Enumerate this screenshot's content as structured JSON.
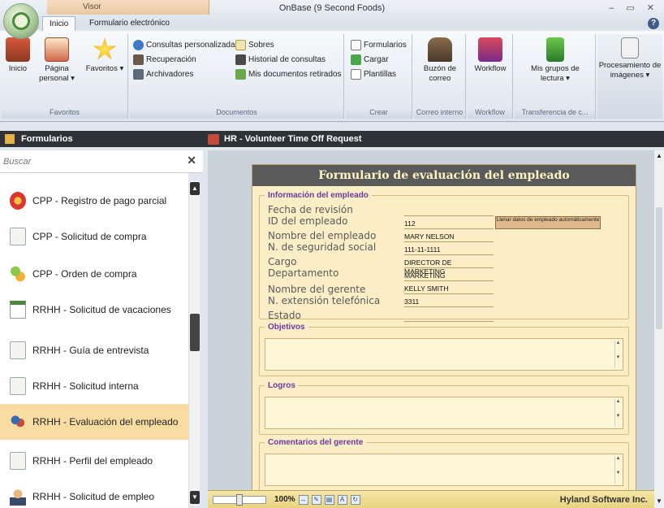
{
  "window": {
    "title": "OnBase (9 Second Foods)",
    "visor_tab": "Visor",
    "controls": "– ▭ ✕"
  },
  "ribbon_tabs": [
    {
      "label": "Inicio",
      "active": true
    },
    {
      "label": "Formulario electrónico",
      "active": false
    }
  ],
  "ribbon": {
    "groups": {
      "favoritos": "Favoritos",
      "documentos": "Documentos",
      "crear": "Crear",
      "correo": "Correo interno",
      "workflow": "Workflow",
      "transferencia": "Transferencia de c..."
    },
    "inicio": "Inicio",
    "pagina_personal": "Página personal ▾",
    "favoritos_btn": "Favoritos ▾",
    "consultas": "Consultas personalizadas",
    "recuperacion": "Recuperación",
    "archivadores": "Archivadores",
    "sobres": "Sobres",
    "historial": "Historial de consultas",
    "retirados": "Mis documentos retirados",
    "formularios": "Formularios",
    "cargar": "Cargar",
    "plantillas": "Plantillas",
    "buzon": "Buzón de correo",
    "workflow_btn": "Workflow",
    "mis_grupos": "Mis grupos de lectura ▾",
    "procesamiento": "Procesamiento de imágenes ▾"
  },
  "left_panel": {
    "title": "Formularios",
    "search_placeholder": "Buscar",
    "items": [
      {
        "label": "CPP - Registro de pago parcial"
      },
      {
        "label": "CPP - Solicitud de compra"
      },
      {
        "label": "CPP - Orden de compra"
      },
      {
        "label": "RRHH - Solicitud de vacaciones"
      },
      {
        "label": "RRHH - Guía de entrevista"
      },
      {
        "label": "RRHH - Solicitud interna"
      },
      {
        "label": "RRHH - Evaluación del empleado"
      },
      {
        "label": "RRHH - Perfil del empleado"
      },
      {
        "label": "RRHH - Solicitud de empleo"
      }
    ]
  },
  "viewer": {
    "title": "HR - Volunteer Time Off Request"
  },
  "form": {
    "title": "Formulario de evaluación del empleado",
    "section_info": "Información del empleado",
    "labels": {
      "fecha": "Fecha de revisión",
      "id": "ID del empleado",
      "nombre": "Nombre del empleado",
      "seguridad": "N. de seguridad social",
      "cargo": "Cargo",
      "departamento": "Departamento",
      "gerente": "Nombre del gerente",
      "extension": "N. extensión telefónica",
      "estado": "Estado"
    },
    "values": {
      "id": "112",
      "nombre": "MARY NELSON",
      "seguridad": "111-11-1111",
      "cargo": "DIRECTOR DE MARKETING",
      "departamento": "MARKETING",
      "gerente": "KELLY SMITH",
      "extension": "3311"
    },
    "fill_button": "Llenar datos de empleado automáticamente",
    "section_objetivos": "Objetivos",
    "section_logros": "Logros",
    "section_comentarios": "Comentarios del gerente"
  },
  "statusbar": {
    "zoom": "100%",
    "company": "Hyland Software Inc."
  }
}
